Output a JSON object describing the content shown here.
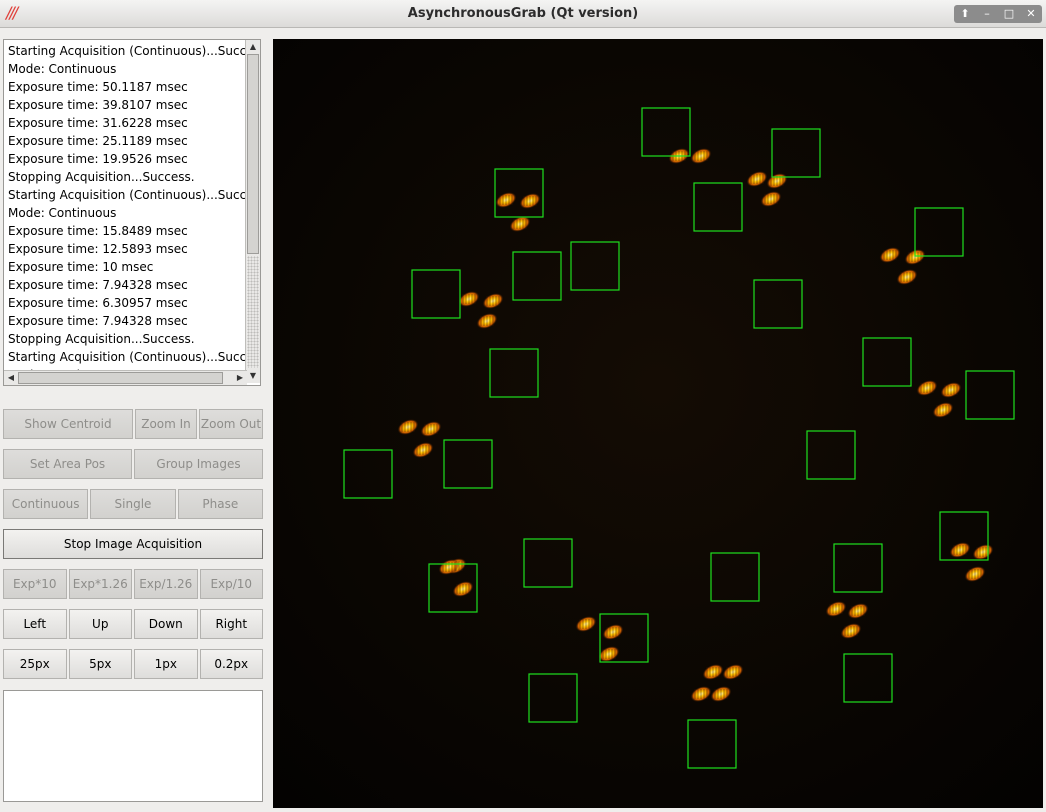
{
  "window": {
    "title": "AsynchronousGrab (Qt version)",
    "logo": "///",
    "controls": [
      {
        "name": "keep-above-icon",
        "glyph": "⬆"
      },
      {
        "name": "minimize-icon",
        "glyph": "–"
      },
      {
        "name": "maximize-icon",
        "glyph": "□"
      },
      {
        "name": "close-icon",
        "glyph": "✕"
      }
    ]
  },
  "log": {
    "lines": [
      "Starting Acquisition (Continuous)...Success.",
      "Mode: Continuous",
      "Exposure time: 50.1187 msec",
      "Exposure time: 39.8107 msec",
      "Exposure time: 31.6228 msec",
      "Exposure time: 25.1189 msec",
      "Exposure time: 19.9526 msec",
      "Stopping Acquisition...Success.",
      "Starting Acquisition (Continuous)...Success.",
      "Mode: Continuous",
      "Exposure time: 15.8489 msec",
      "Exposure time: 12.5893 msec",
      "Exposure time: 10 msec",
      "Exposure time: 7.94328 msec",
      "Exposure time: 6.30957 msec",
      "Exposure time: 7.94328 msec",
      "Stopping Acquisition...Success.",
      "Starting Acquisition (Continuous)...Success.",
      "Mode: Continuous"
    ]
  },
  "buttons": {
    "show_centroid": "Show Centroid",
    "zoom_in": "Zoom In",
    "zoom_out": "Zoom Out",
    "set_area_pos": "Set Area Pos",
    "group_images": "Group Images",
    "continuous": "Continuous",
    "single": "Single",
    "phase": "Phase",
    "stop_acquisition": "Stop Image Acquisition",
    "exp_x10": "Exp*10",
    "exp_x126": "Exp*1.26",
    "exp_d126": "Exp/1.26",
    "exp_d10": "Exp/10",
    "left": "Left",
    "up": "Up",
    "down": "Down",
    "right": "Right",
    "step_25": "25px",
    "step_5": "5px",
    "step_1": "1px",
    "step_02": "0.2px"
  },
  "colors": {
    "roi_box": "#1ee01e",
    "spot_core": "#ffd000",
    "spot_edge": "#d86a00",
    "viewport_bg": "#050403"
  }
}
